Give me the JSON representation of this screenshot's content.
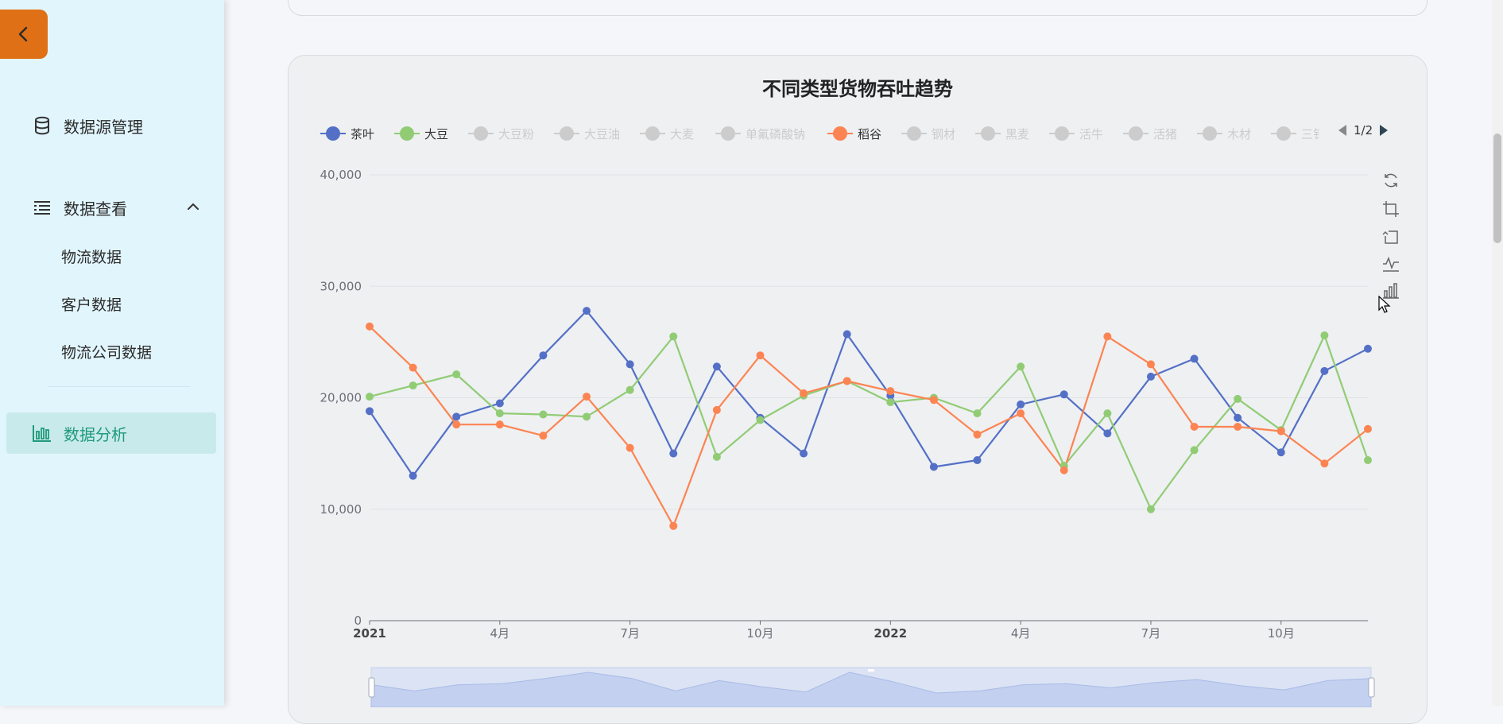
{
  "sidebar": {
    "items": [
      {
        "label": "数据源管理",
        "icon": "database-icon"
      },
      {
        "label": "数据查看",
        "icon": "list-icon",
        "expanded": true,
        "children": [
          {
            "label": "物流数据"
          },
          {
            "label": "客户数据"
          },
          {
            "label": "物流公司数据"
          }
        ]
      },
      {
        "label": "数据分析",
        "icon": "bar-chart-icon",
        "active": true
      }
    ]
  },
  "legend": {
    "items": [
      {
        "name": "茶叶",
        "color": "#5470c6",
        "active": true
      },
      {
        "name": "大豆",
        "color": "#91cc75",
        "active": true
      },
      {
        "name": "大豆粉",
        "active": false
      },
      {
        "name": "大豆油",
        "active": false
      },
      {
        "name": "大麦",
        "active": false
      },
      {
        "name": "单氟磷酸钠",
        "active": false
      },
      {
        "name": "稻谷",
        "color": "#fc8452",
        "active": true
      },
      {
        "name": "钢材",
        "active": false
      },
      {
        "name": "黑麦",
        "active": false
      },
      {
        "name": "活牛",
        "active": false
      },
      {
        "name": "活猪",
        "active": false
      },
      {
        "name": "木材",
        "active": false
      },
      {
        "name": "三钅",
        "active": false
      }
    ],
    "page": "1/2",
    "inactive_color": "#cccccc"
  },
  "toolbox": [
    "restore-icon",
    "data-zoom-icon",
    "zoom-reset-icon",
    "line-type-icon",
    "bar-type-icon"
  ],
  "chart_data": {
    "type": "line",
    "title": "不同类型货物吞吐趋势",
    "x_ticks": [
      "2021",
      "4月",
      "7月",
      "10月",
      "2022",
      "4月",
      "7月",
      "10月"
    ],
    "x_ticks_bold": [
      "2021",
      "2022"
    ],
    "y_ticks": [
      "0",
      "10,000",
      "20,000",
      "30,000",
      "40,000"
    ],
    "ylim": [
      0,
      40000
    ],
    "x": [
      "2021-01",
      "2021-02",
      "2021-03",
      "2021-04",
      "2021-05",
      "2021-06",
      "2021-07",
      "2021-08",
      "2021-09",
      "2021-10",
      "2021-11",
      "2021-12",
      "2022-01",
      "2022-02",
      "2022-03",
      "2022-04",
      "2022-05",
      "2022-06",
      "2022-07",
      "2022-08",
      "2022-09",
      "2022-10",
      "2022-11",
      "2022-12"
    ],
    "series": [
      {
        "name": "茶叶",
        "color": "#5470c6",
        "values": [
          18800,
          13000,
          18300,
          19500,
          23800,
          27800,
          23000,
          15000,
          22800,
          18200,
          15000,
          25700,
          20200,
          13800,
          14400,
          19400,
          20300,
          16800,
          21900,
          23500,
          18200,
          15100,
          22400,
          24400
        ]
      },
      {
        "name": "大豆",
        "color": "#91cc75",
        "values": [
          20100,
          21100,
          22100,
          18600,
          18500,
          18300,
          20700,
          25500,
          14700,
          18000,
          20200,
          21500,
          19600,
          20000,
          18600,
          22800,
          13900,
          18600,
          10000,
          15300,
          19900,
          17100,
          25600,
          14400
        ]
      },
      {
        "name": "稻谷",
        "color": "#fc8452",
        "values": [
          26400,
          22700,
          17600,
          17600,
          16600,
          20100,
          15500,
          8500,
          18900,
          23800,
          20400,
          21500,
          20600,
          19800,
          16700,
          18600,
          13500,
          25500,
          23000,
          17400,
          17400,
          17000,
          14100,
          17200
        ]
      }
    ],
    "grid": true,
    "legend_position": "top"
  },
  "data_zoom": {
    "sparkline": [
      17000,
      14000,
      17000,
      17500,
      20000,
      23000,
      20000,
      14000,
      19000,
      16000,
      13500,
      23000,
      18500,
      13000,
      14000,
      17000,
      17500,
      15500,
      18000,
      19500,
      16500,
      14500,
      19000,
      20000
    ]
  }
}
